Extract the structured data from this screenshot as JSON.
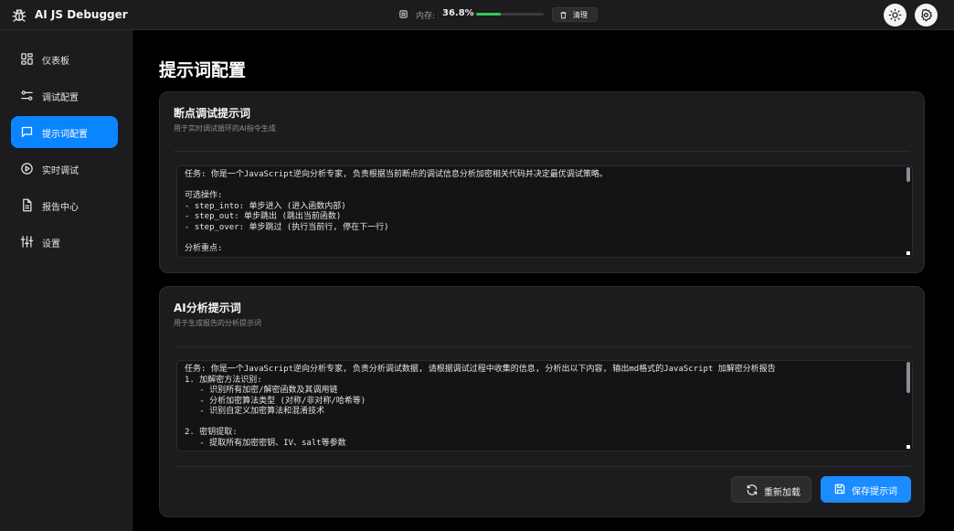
{
  "app": {
    "title": "AI JS Debugger",
    "logo_icon": "bug-icon"
  },
  "header": {
    "memory_label": "内存:",
    "memory_value": "36.8%",
    "memory_percent": 36.8,
    "memory_color": "#34c759",
    "clean_label": "清理",
    "theme_icon": "sun-icon",
    "settings_icon": "gear-icon"
  },
  "sidebar": {
    "items": [
      {
        "label": "仪表板",
        "icon": "dashboard-grid-icon",
        "active": false
      },
      {
        "label": "调试配置",
        "icon": "sliders-icon",
        "active": false
      },
      {
        "label": "提示词配置",
        "icon": "chat-bubble-icon",
        "active": true
      },
      {
        "label": "实时调试",
        "icon": "play-circle-icon",
        "active": false
      },
      {
        "label": "报告中心",
        "icon": "document-icon",
        "active": false
      },
      {
        "label": "设置",
        "icon": "sliders-vertical-icon",
        "active": false
      }
    ],
    "active_color": "#0a84ff"
  },
  "main": {
    "page_title": "提示词配置",
    "cards": [
      {
        "title": "断点调试提示词",
        "subtitle": "用于实时调试循环的AI指令生成",
        "content": "任务: 你是一个JavaScript逆向分析专家, 负责根据当前断点的调试信息分析加密相关代码并决定最优调试策略。\n\n可选操作:\n- step_into: 单步进入 (进入函数内部)\n- step_out: 单步跳出 (跳出当前函数)\n- step_over: 单步跳过 (执行当前行, 停在下一行)\n\n分析重点:"
      },
      {
        "title": "AI分析提示词",
        "subtitle": "用于生成报告的分析提示词",
        "content": "任务: 你是一个JavaScript逆向分析专家, 负责分析调试数据, 请根据调试过程中收集的信息, 分析出以下内容, 输出md格式的JavaScript 加解密分析报告\n1. 加解密方法识别:\n   - 识别所有加密/解密函数及其调用链\n   - 分析加密算法类型 (对称/非对称/哈希等)\n   - 识别自定义加密算法和混淆技术\n\n2. 密钥提取:\n   - 提取所有加密密钥、IV、salt等参数"
      }
    ],
    "reload_label": "重新加载",
    "save_label": "保存提示词",
    "save_color": "#1a8cff"
  }
}
